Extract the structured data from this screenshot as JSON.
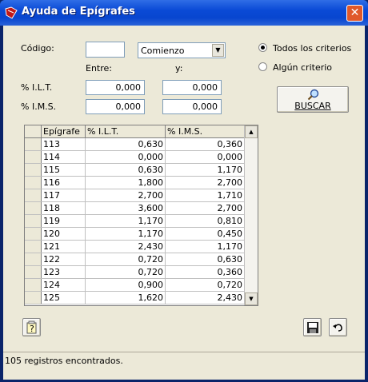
{
  "window": {
    "title": "Ayuda de Epígrafes",
    "close_glyph": "✕"
  },
  "form": {
    "codigo_label": "Código:",
    "codigo_value": "",
    "match_select": "Comienzo",
    "entre_label": "Entre:",
    "y_label": "y:",
    "ilt_label": "% I.L.T.",
    "ilt_from": "0,000",
    "ilt_to": "0,000",
    "ims_label": "% I.M.S.",
    "ims_from": "0,000",
    "ims_to": "0,000",
    "radio_all": "Todos los criterios",
    "radio_any": "Algún criterio",
    "search_button": "BUSCAR"
  },
  "table": {
    "columns": [
      "Epígrafe",
      "% I.L.T.",
      "% I.M.S."
    ],
    "rows": [
      [
        "113",
        "0,630",
        "0,360"
      ],
      [
        "114",
        "0,000",
        "0,000"
      ],
      [
        "115",
        "0,630",
        "1,170"
      ],
      [
        "116",
        "1,800",
        "2,700"
      ],
      [
        "117",
        "2,700",
        "1,710"
      ],
      [
        "118",
        "3,600",
        "2,700"
      ],
      [
        "119",
        "1,170",
        "0,810"
      ],
      [
        "120",
        "1,170",
        "0,450"
      ],
      [
        "121",
        "2,430",
        "1,170"
      ],
      [
        "122",
        "0,720",
        "0,630"
      ],
      [
        "123",
        "0,720",
        "0,360"
      ],
      [
        "124",
        "0,900",
        "0,720"
      ],
      [
        "125",
        "1,620",
        "2,430"
      ]
    ]
  },
  "status": {
    "text": "105 registros encontrados."
  },
  "icons": {
    "app": "book-icon",
    "help": "help-notepad-icon",
    "save": "floppy-disk-icon",
    "undo": "undo-arrow-icon",
    "search": "magnifier-icon"
  },
  "colors": {
    "titlebar": "#0a4ad6",
    "face": "#ece9d8",
    "close": "#e0582a"
  }
}
